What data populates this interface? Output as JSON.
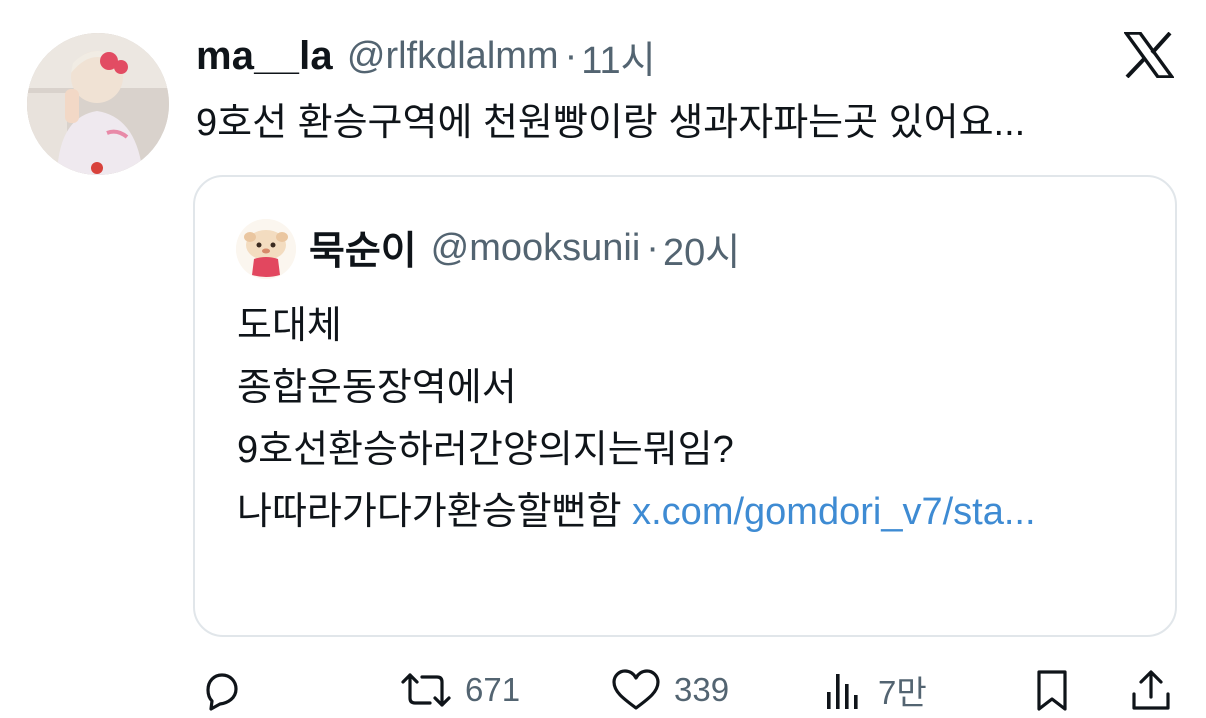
{
  "tweet": {
    "display_name": "ma__la",
    "handle": "@rlfkdlalmm",
    "separator": "·",
    "time": "11시",
    "text": "9호선 환승구역에 천원빵이랑 생과자파는곳 있어요..."
  },
  "quote": {
    "display_name": "묵순이",
    "handle": "@mooksunii",
    "separator": "·",
    "time": "20시",
    "lines": [
      "도대체",
      "종합운동장역에서",
      "9호선환승하러간양의지는뭐임?"
    ],
    "last_line_text": "나따라가다가환승할뻔함",
    "link_text": "x.com/gomdori_v7/sta..."
  },
  "actions": {
    "reply": {
      "icon": "reply-icon"
    },
    "retweet": {
      "icon": "retweet-icon",
      "count": "671"
    },
    "like": {
      "icon": "heart-icon",
      "count": "339"
    },
    "views": {
      "icon": "views-icon",
      "count": "7만"
    },
    "bookmark": {
      "icon": "bookmark-icon"
    },
    "share": {
      "icon": "share-icon"
    }
  },
  "colors": {
    "text": "#0f1419",
    "secondary": "#536471",
    "link": "#3e8bd3",
    "border": "#e1e6ea"
  }
}
